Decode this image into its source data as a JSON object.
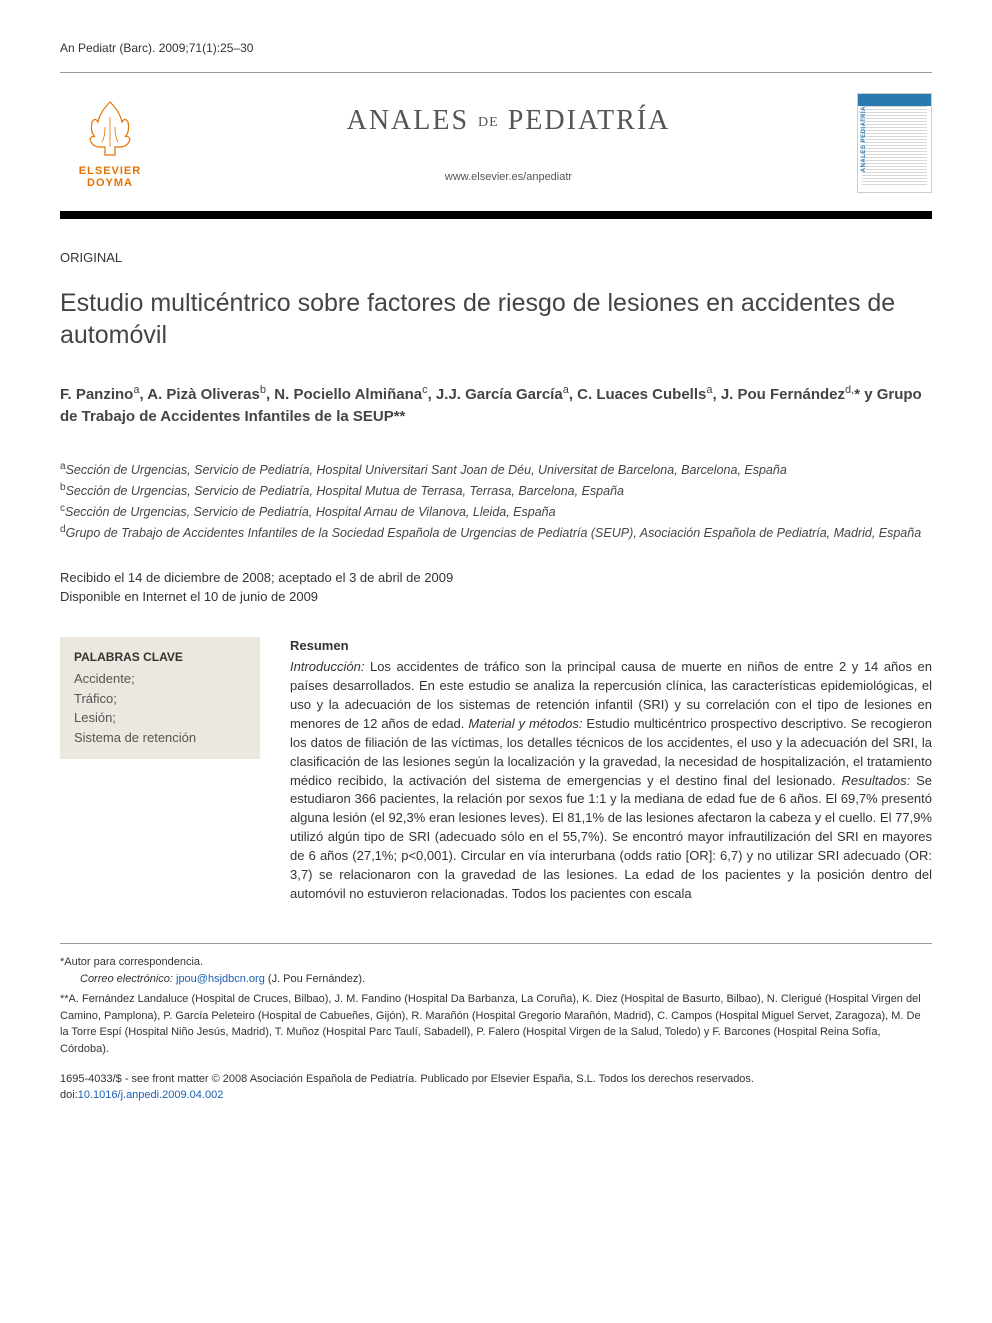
{
  "header_ref": "An Pediatr (Barc). 2009;71(1):25–30",
  "publisher": {
    "name": "ELSEVIER\nDOYMA"
  },
  "journal": {
    "title_main": "ANALES",
    "title_de": "DE",
    "title_sub": "PEDIATRÍA",
    "url": "www.elsevier.es/anpediatr"
  },
  "section_label": "ORIGINAL",
  "title": "Estudio multicéntrico sobre factores de riesgo de lesiones en accidentes de automóvil",
  "authors_html": "F. Panzino<sup>a</sup>, A. Pizà Oliveras<sup>b</sup>, N. Pociello Almiñana<sup>c</sup>, J.J. García García<sup>a</sup>, C. Luaces Cubells<sup>a</sup>, J. Pou Fernández<sup>d,</sup>* y Grupo de Trabajo de Accidentes Infantiles de la SEUP**",
  "affiliations": [
    {
      "sup": "a",
      "text": "Sección de Urgencias, Servicio de Pediatría, Hospital Universitari Sant Joan de Déu, Universitat de Barcelona, Barcelona, España"
    },
    {
      "sup": "b",
      "text": "Sección de Urgencias, Servicio de Pediatría, Hospital Mutua de Terrasa, Terrasa, Barcelona, España"
    },
    {
      "sup": "c",
      "text": "Sección de Urgencias, Servicio de Pediatría, Hospital Arnau de Vilanova, Lleida, España"
    },
    {
      "sup": "d",
      "text": "Grupo de Trabajo de Accidentes Infantiles de la Sociedad Española de Urgencias de Pediatría (SEUP), Asociación Española de Pediatría, Madrid, España"
    }
  ],
  "dates": {
    "received_accepted": "Recibido el 14 de diciembre de 2008; aceptado el 3 de abril de 2009",
    "online": "Disponible en Internet el 10 de junio de 2009"
  },
  "keywords": {
    "title": "PALABRAS CLAVE",
    "items": [
      "Accidente;",
      "Tráfico;",
      "Lesión;",
      "Sistema de retención"
    ]
  },
  "abstract": {
    "title": "Resumen",
    "sections": [
      {
        "label": "Introducción:",
        "text": "Los accidentes de tráfico son la principal causa de muerte en niños de entre 2 y 14 años en países desarrollados. En este estudio se analiza la repercusión clínica, las características epidemiológicas, el uso y la adecuación de los sistemas de retención infantil (SRI) y su correlación con el tipo de lesiones en menores de 12 años de edad."
      },
      {
        "label": "Material y métodos:",
        "text": "Estudio multicéntrico prospectivo descriptivo. Se recogieron los datos de filiación de las víctimas, los detalles técnicos de los accidentes, el uso y la adecuación del SRI, la clasificación de las lesiones según la localización y la gravedad, la necesidad de hospitalización, el tratamiento médico recibido, la activación del sistema de emergencias y el destino final del lesionado."
      },
      {
        "label": "Resultados:",
        "text": "Se estudiaron 366 pacientes, la relación por sexos fue 1:1 y la mediana de edad fue de 6 años. El 69,7% presentó alguna lesión (el 92,3% eran lesiones leves). El 81,1% de las lesiones afectaron la cabeza y el cuello. El 77,9% utilizó algún tipo de SRI (adecuado sólo en el 55,7%). Se encontró mayor infrautilización del SRI en mayores de 6 años (27,1%; p<0,001). Circular en vía interurbana (odds ratio [OR]: 6,7) y no utilizar SRI adecuado (OR: 3,7) se relacionaron con la gravedad de las lesiones. La edad de los pacientes y la posición dentro del automóvil no estuvieron relacionadas. Todos los pacientes con escala"
      }
    ]
  },
  "footnotes": {
    "corresponding": "*Autor para correspondencia.",
    "email_label": "Correo electrónico:",
    "email": "jpou@hsjdbcn.org",
    "email_name": "(J. Pou Fernández).",
    "group": "**A. Fernández Landaluce (Hospital de Cruces, Bilbao), J. M. Fandino (Hospital Da Barbanza, La Coruña), K. Diez (Hospital de Basurto, Bilbao), N. Clerigué (Hospital Virgen del Camino, Pamplona), P. García Peleteiro (Hospital de Cabueñes, Gijón), R. Marañón (Hospital Gregorio Marañón, Madrid), C. Campos (Hospital Miguel Servet, Zaragoza), M. De la Torre Espí (Hospital Niño Jesús, Madrid), T. Muñoz (Hospital Parc Taulí, Sabadell), P. Falero (Hospital Virgen de la Salud, Toledo) y F. Barcones (Hospital Reina Sofía, Córdoba)."
  },
  "copyright": "1695-4033/$ - see front matter © 2008 Asociación Española de Pediatría. Publicado por Elsevier España, S.L. Todos los derechos reservados.",
  "doi_label": "doi:",
  "doi": "10.1016/j.anpedi.2009.04.002"
}
